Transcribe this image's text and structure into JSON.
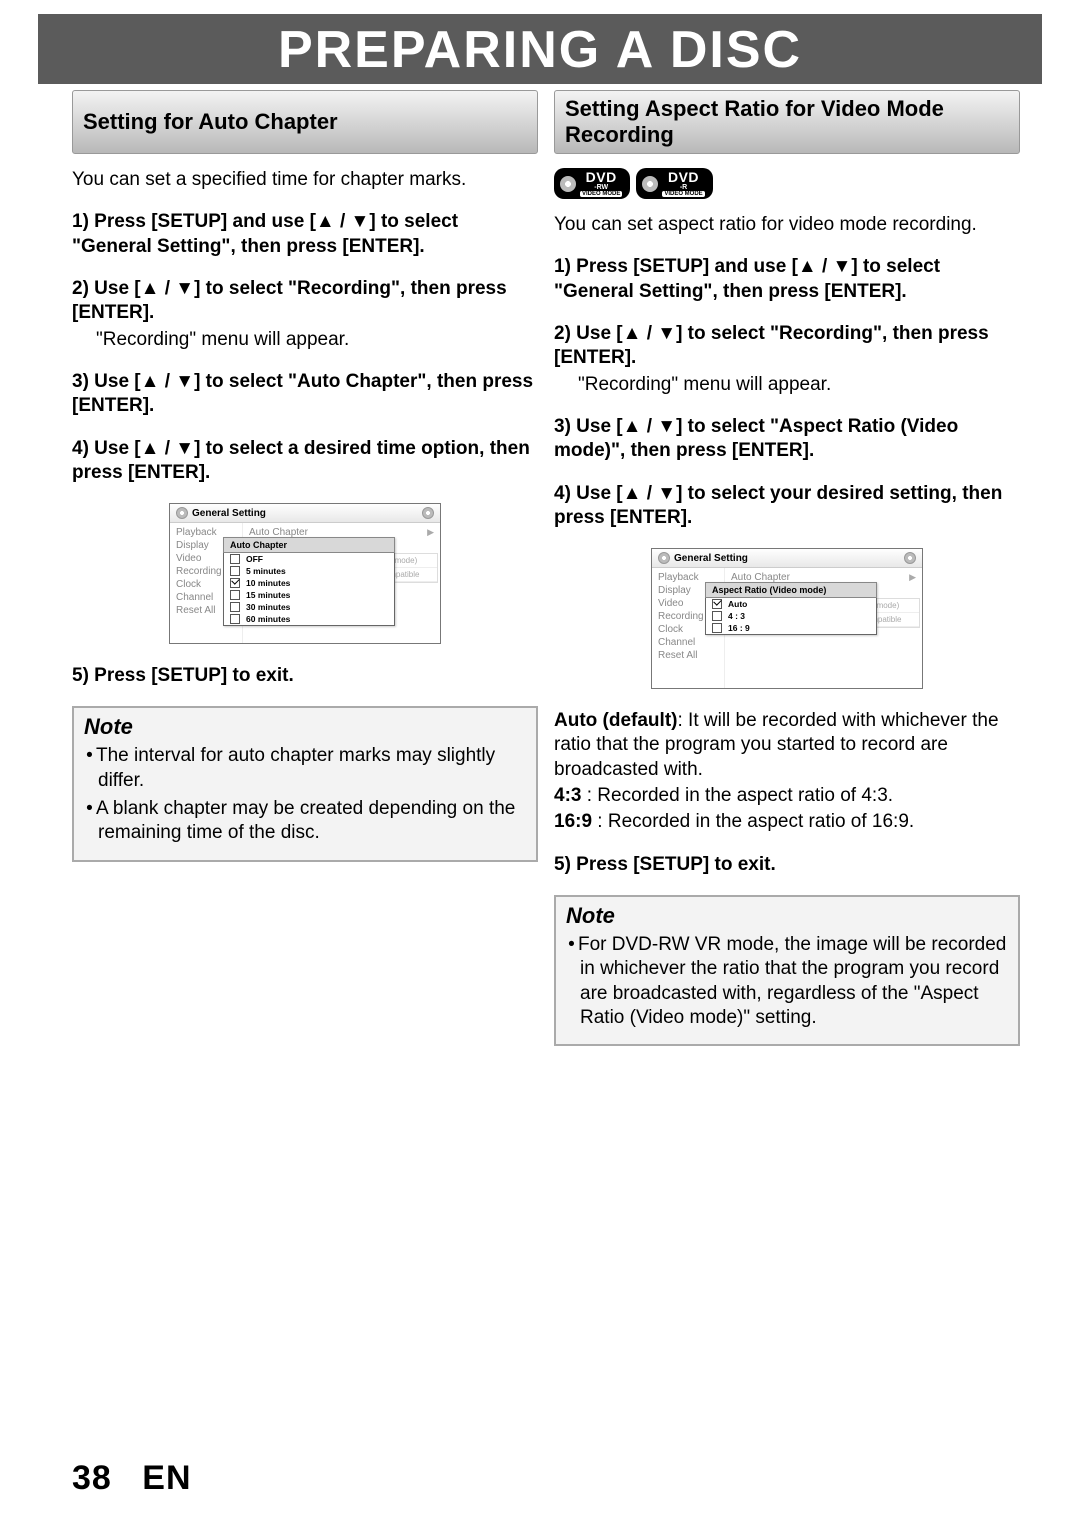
{
  "banner": "PREPARING A DISC",
  "left": {
    "section_title": "Setting for Auto Chapter",
    "intro": "You can set a specified time for chapter marks.",
    "step1": "1) Press [SETUP] and use [▲ / ▼] to select \"General Setting\", then press [ENTER].",
    "step2": "2) Use [▲ / ▼] to select \"Recording\", then press [ENTER].",
    "step2_sub": "\"Recording\" menu will appear.",
    "step3": "3) Use [▲ / ▼] to select \"Auto Chapter\", then press [ENTER].",
    "step4": "4) Use [▲ / ▼] to select a desired time option, then press [ENTER].",
    "step5": "5) Press [SETUP] to exit.",
    "menu": {
      "title": "General Setting",
      "left_items": [
        "Playback",
        "Display",
        "Video",
        "Recording",
        "Clock",
        "Channel",
        "Reset All"
      ],
      "right_top": "Auto Chapter",
      "submenu_title": "Auto Chapter",
      "options": [
        "OFF",
        "5 minutes",
        "10 minutes",
        "15 minutes",
        "30 minutes",
        "60 minutes"
      ],
      "checked_index": 2,
      "ghost_items": [
        "deo mode)",
        "Compatible"
      ]
    },
    "note_title": "Note",
    "note_items": [
      "The interval for auto chapter marks may slightly differ.",
      "A blank chapter may be created depending on the remaining time of the disc."
    ]
  },
  "right": {
    "section_title": "Setting Aspect Ratio for Video Mode Recording",
    "badges": [
      {
        "top": "DVD",
        "mid": "-RW",
        "bot": "VIDEO MODE"
      },
      {
        "top": "DVD",
        "mid": "-R",
        "bot": "VIDEO MODE"
      }
    ],
    "intro": "You can set aspect ratio for video mode recording.",
    "step1": "1) Press [SETUP] and use [▲ / ▼] to select \"General Setting\", then press [ENTER].",
    "step2": "2) Use [▲ / ▼] to select \"Recording\", then press [ENTER].",
    "step2_sub": "\"Recording\" menu will appear.",
    "step3": "3) Use [▲ / ▼] to select \"Aspect Ratio (Video mode)\", then press [ENTER].",
    "step4": "4) Use [▲ / ▼] to select your desired setting, then press [ENTER].",
    "step5": "5) Press [SETUP] to exit.",
    "menu": {
      "title": "General Setting",
      "left_items": [
        "Playback",
        "Display",
        "Video",
        "Recording",
        "Clock",
        "Channel",
        "Reset All"
      ],
      "right_top": "Auto Chapter",
      "submenu_title": "Aspect Ratio (Video mode)",
      "options": [
        "Auto",
        "4 : 3",
        "16 : 9"
      ],
      "checked_index": 0,
      "ghost_items": [
        "deo mode)",
        "Compatible"
      ]
    },
    "desc_auto_label": "Auto (default)",
    "desc_auto": ": It will be recorded with whichever the ratio that the program you started to record are broadcasted with.",
    "desc_43_label": "4:3",
    "desc_43": " :    Recorded in the aspect ratio of 4:3.",
    "desc_169_label": "16:9",
    "desc_169": " :  Recorded in the aspect ratio of 16:9.",
    "note_title": "Note",
    "note_items": [
      "For DVD-RW VR mode, the image will be recorded in whichever the ratio that the program you record are broadcasted with, regardless of the \"Aspect Ratio (Video mode)\" setting."
    ]
  },
  "footer": {
    "page": "38",
    "lang": "EN"
  }
}
